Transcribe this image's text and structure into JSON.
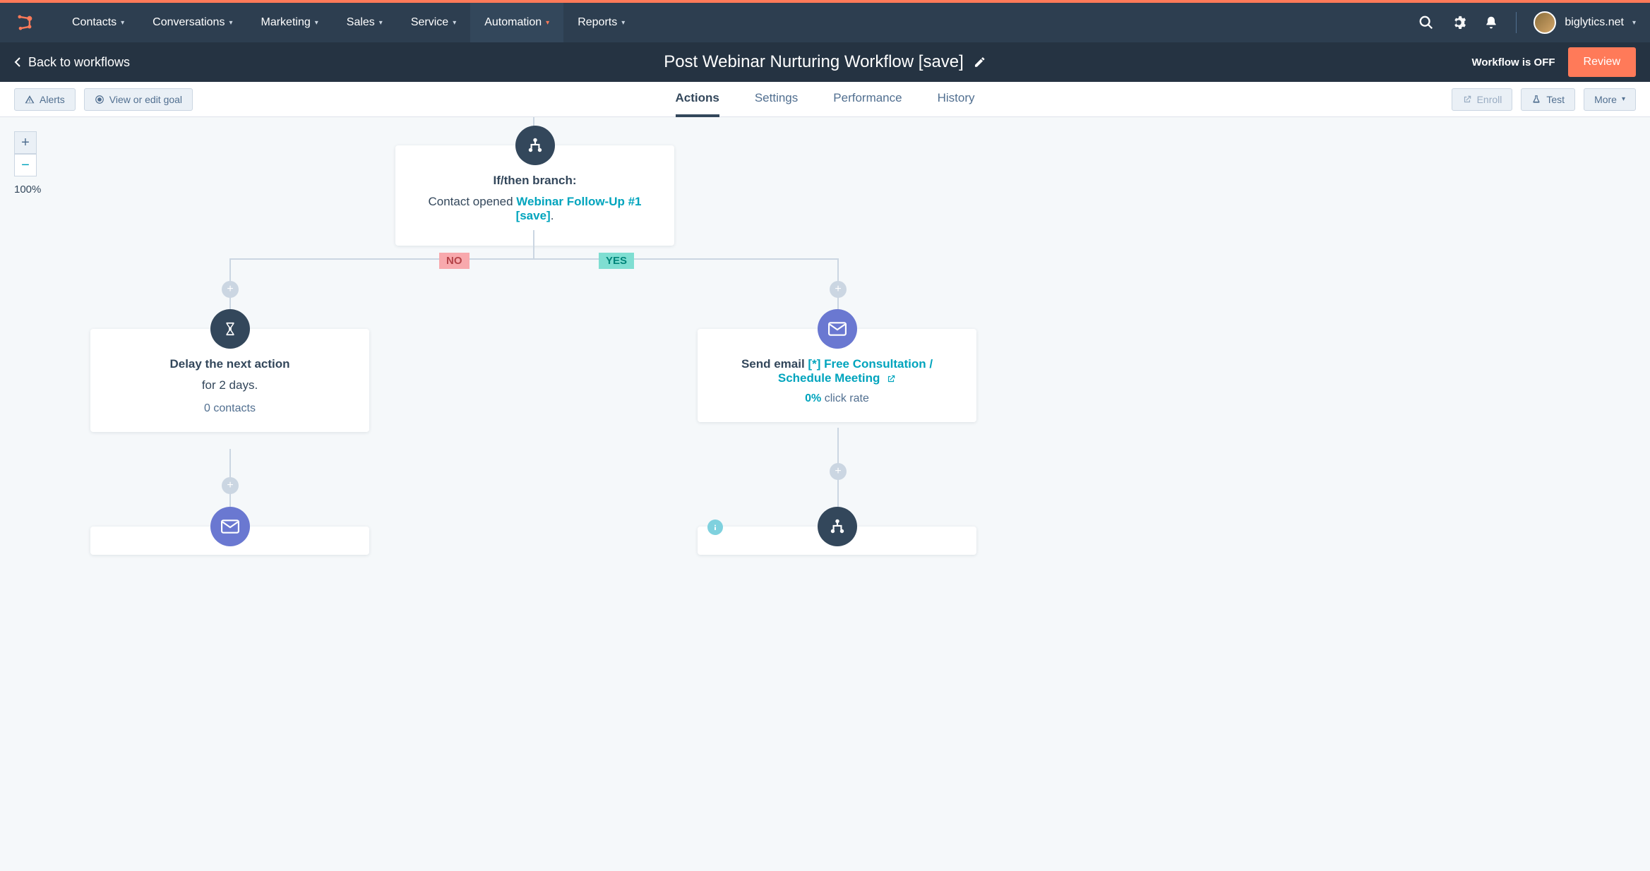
{
  "nav": {
    "items": [
      {
        "label": "Contacts"
      },
      {
        "label": "Conversations"
      },
      {
        "label": "Marketing"
      },
      {
        "label": "Sales"
      },
      {
        "label": "Service"
      },
      {
        "label": "Automation",
        "active": true
      },
      {
        "label": "Reports"
      }
    ],
    "account": "biglytics.net"
  },
  "subheader": {
    "back": "Back to workflows",
    "title": "Post Webinar Nurturing Workflow [save]",
    "status": "Workflow is OFF",
    "review": "Review"
  },
  "toolbar": {
    "alerts": "Alerts",
    "goal": "View or edit goal",
    "tabs": [
      {
        "label": "Actions",
        "active": true
      },
      {
        "label": "Settings"
      },
      {
        "label": "Performance"
      },
      {
        "label": "History"
      }
    ],
    "enroll": "Enroll",
    "test": "Test",
    "more": "More"
  },
  "zoom": {
    "pct": "100%"
  },
  "nodes": {
    "branch": {
      "title": "If/then branch:",
      "prefix": "Contact opened ",
      "link": "Webinar Follow-Up #1 [save]",
      "suffix": "."
    },
    "branchLabels": {
      "no": "NO",
      "yes": "YES"
    },
    "delay": {
      "title": "Delay the next action",
      "sub": "for 2 days.",
      "stat": "0 contacts"
    },
    "email": {
      "prefix": "Send email ",
      "link": "[*] Free Consultation / Schedule Meeting",
      "statPct": "0%",
      "statLabel": " click rate"
    }
  }
}
